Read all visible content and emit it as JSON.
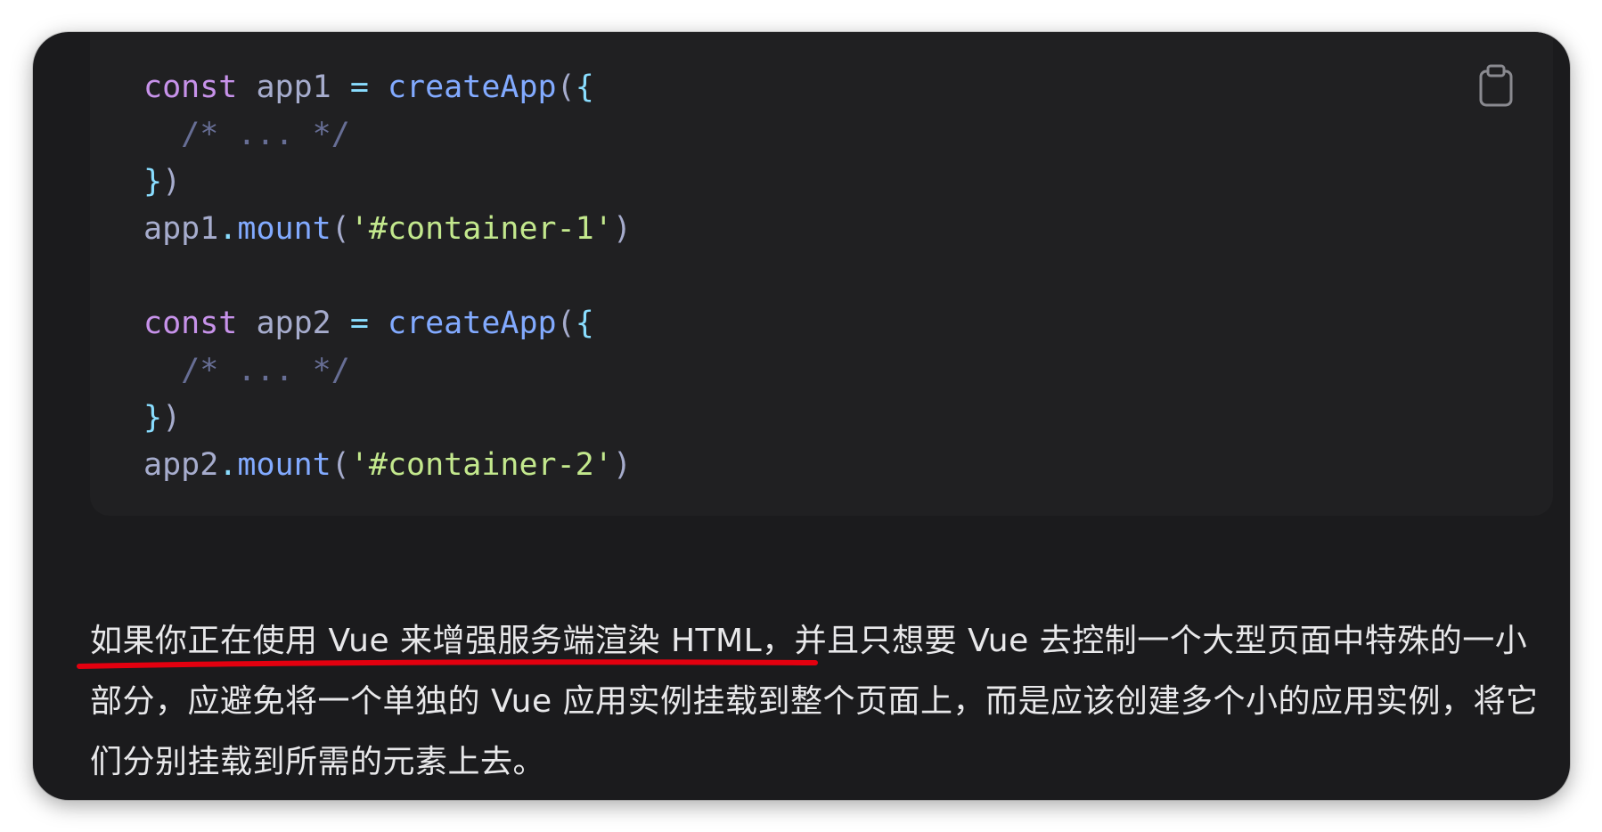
{
  "code_block": {
    "lines": [
      [
        {
          "t": "const",
          "k": "kw"
        },
        {
          "t": " ",
          "k": "id"
        },
        {
          "t": "app1",
          "k": "id"
        },
        {
          "t": " ",
          "k": "id"
        },
        {
          "t": "=",
          "k": "op"
        },
        {
          "t": " ",
          "k": "id"
        },
        {
          "t": "createApp",
          "k": "fn"
        },
        {
          "t": "(",
          "k": "paren"
        },
        {
          "t": "{",
          "k": "punc"
        }
      ],
      [
        {
          "t": "  /* ... */",
          "k": "com"
        }
      ],
      [
        {
          "t": "}",
          "k": "punc"
        },
        {
          "t": ")",
          "k": "paren"
        }
      ],
      [
        {
          "t": "app1",
          "k": "id"
        },
        {
          "t": ".",
          "k": "op"
        },
        {
          "t": "mount",
          "k": "fn"
        },
        {
          "t": "(",
          "k": "paren"
        },
        {
          "t": "'#container-1'",
          "k": "str"
        },
        {
          "t": ")",
          "k": "paren"
        }
      ],
      [],
      [
        {
          "t": "const",
          "k": "kw"
        },
        {
          "t": " ",
          "k": "id"
        },
        {
          "t": "app2",
          "k": "id"
        },
        {
          "t": " ",
          "k": "id"
        },
        {
          "t": "=",
          "k": "op"
        },
        {
          "t": " ",
          "k": "id"
        },
        {
          "t": "createApp",
          "k": "fn"
        },
        {
          "t": "(",
          "k": "paren"
        },
        {
          "t": "{",
          "k": "punc"
        }
      ],
      [
        {
          "t": "  /* ... */",
          "k": "com"
        }
      ],
      [
        {
          "t": "}",
          "k": "punc"
        },
        {
          "t": ")",
          "k": "paren"
        }
      ],
      [
        {
          "t": "app2",
          "k": "id"
        },
        {
          "t": ".",
          "k": "op"
        },
        {
          "t": "mount",
          "k": "fn"
        },
        {
          "t": "(",
          "k": "paren"
        },
        {
          "t": "'#container-2'",
          "k": "str"
        },
        {
          "t": ")",
          "k": "paren"
        }
      ]
    ],
    "copy_icon": "clipboard-icon"
  },
  "paragraph": {
    "highlighted": "如果你正在使用 Vue 来增强服务端渲染 HTML",
    "rest": "，并且只想要 Vue 去控制一个大型页面中特殊的一小部分，应避免将一个单独的 Vue 应用实例挂载到整个页面上，而是应该创建多个小的应用实例，将它们分别挂载到所需的元素上去。"
  },
  "colors": {
    "background": "#1b1b1d",
    "code_background": "#202022",
    "keyword": "#c792ea",
    "function": "#82aaff",
    "string": "#c3e88d",
    "comment": "#676e95",
    "punctuation": "#89ddff",
    "text": "#e8e8ea",
    "annotation_underline": "#e3000f"
  }
}
